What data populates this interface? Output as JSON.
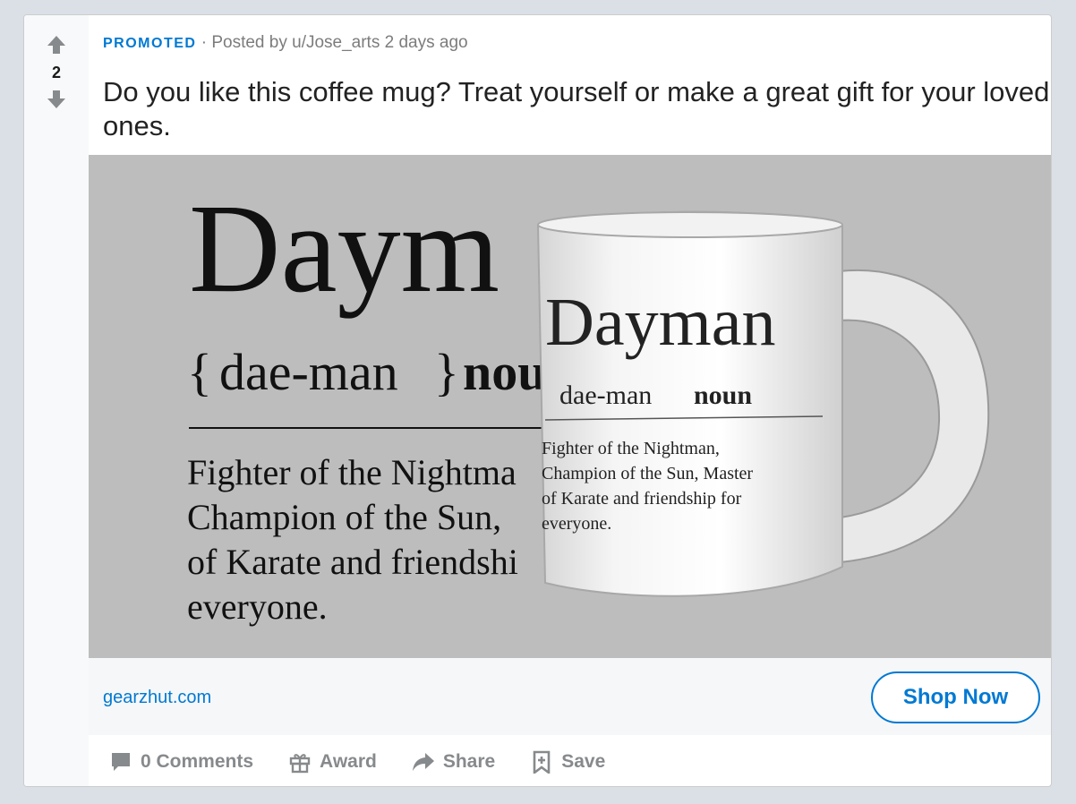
{
  "post": {
    "vote_count": "2",
    "promoted_label": "PROMOTED",
    "meta_separator": " · ",
    "posted_by": "Posted by u/Jose_arts 2 days ago",
    "title": "Do you like this coffee mug? Treat yourself or make a great gift for your loved ones."
  },
  "ad": {
    "bg_heading": "Daym",
    "bg_pronunciation_open": "{",
    "bg_pronunciation": "dae-man",
    "bg_pronunciation_close": "}",
    "bg_pos": "nou",
    "bg_def_lines": [
      "Fighter of the Nightma",
      "Champion of the Sun,",
      "of Karate and friendshi",
      "everyone."
    ],
    "mug_heading": "Dayman",
    "mug_pronunciation": "dae-man",
    "mug_pos": "noun",
    "mug_def_lines": [
      "Fighter of the Nightman,",
      "Champion of the Sun, Master",
      "of Karate and friendship for",
      "everyone."
    ]
  },
  "link": {
    "domain": "gearzhut.com",
    "cta": "Shop Now"
  },
  "actions": {
    "comments": "0 Comments",
    "award": "Award",
    "share": "Share",
    "save": "Save"
  },
  "colors": {
    "accent": "#0079d3",
    "muted": "#878a8c",
    "page_bg": "#dae0e6"
  },
  "icons": [
    "upvote-icon",
    "downvote-icon",
    "comment-icon",
    "gift-icon",
    "share-icon",
    "save-icon"
  ]
}
